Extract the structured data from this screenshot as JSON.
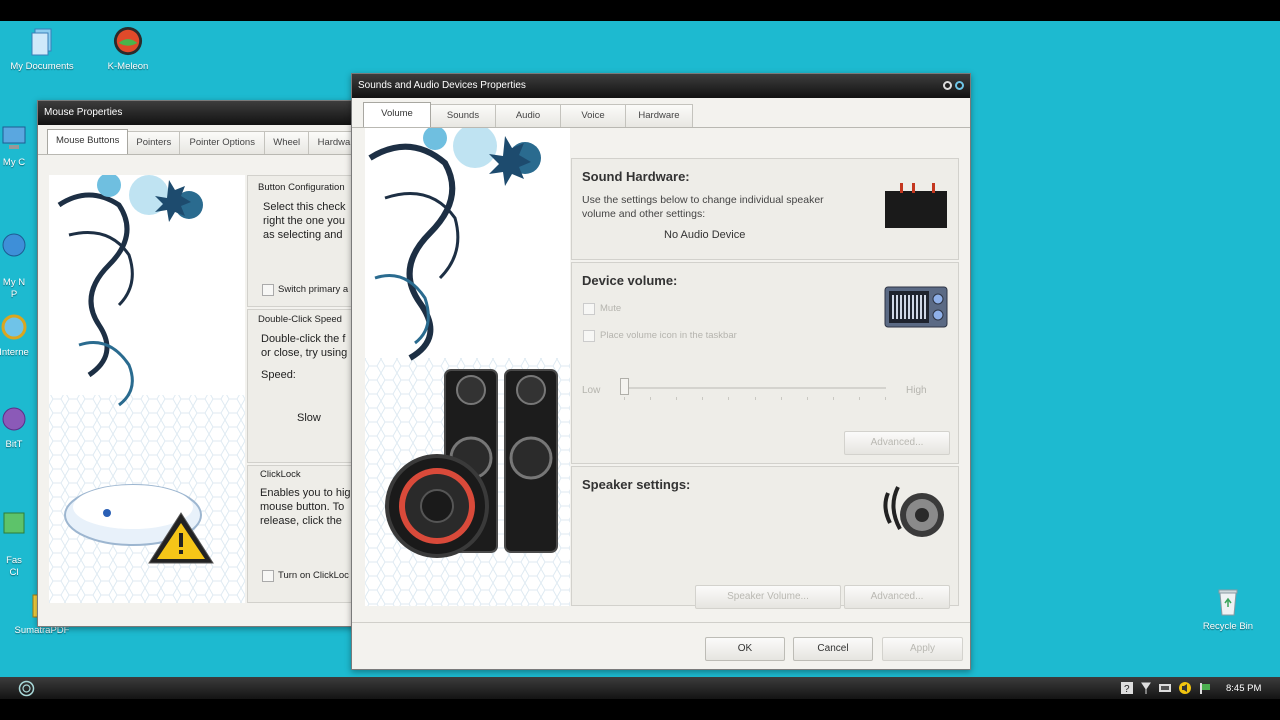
{
  "desktop": {
    "icons": [
      {
        "label": "My Documents",
        "icon": "documents-icon"
      },
      {
        "label": "K-Meleon",
        "icon": "k-meleon-icon"
      },
      {
        "label": "My C",
        "icon": "computer-icon"
      },
      {
        "label": "My N\nP",
        "icon": "network-icon"
      },
      {
        "label": "Interne",
        "icon": "internet-icon"
      },
      {
        "label": "BitT",
        "icon": "bittorrent-icon"
      },
      {
        "label": "Fas\nCl",
        "icon": "app-icon"
      },
      {
        "label": "SumatraPDF",
        "icon": "sumatrapdf-icon"
      },
      {
        "label": "Recycle Bin",
        "icon": "recycle-bin-icon"
      }
    ]
  },
  "mouse_window": {
    "title": "Mouse Properties",
    "tabs": [
      "Mouse Buttons",
      "Pointers",
      "Pointer Options",
      "Wheel",
      "Hardware"
    ],
    "button_config": {
      "title": "Button Configuration",
      "text": "Select this check\nright the one you\nas selecting and",
      "checkbox": "Switch primary a"
    },
    "double_click": {
      "title": "Double-Click Speed",
      "text": "Double-click the f\nor close, try using",
      "speed_label": "Speed:",
      "slow_label": "Slow"
    },
    "clicklock": {
      "title": "ClickLock",
      "text": "Enables you to hig\nmouse button. To\nrelease, click the",
      "checkbox": "Turn on ClickLoc"
    }
  },
  "sound_window": {
    "title": "Sounds and Audio Devices Properties",
    "tabs": [
      "Volume",
      "Sounds",
      "Audio",
      "Voice",
      "Hardware"
    ],
    "sound_hardware": {
      "title": "Sound Hardware:",
      "text": "Use the settings below to change individual speaker\nvolume and other settings:",
      "device": "No Audio Device"
    },
    "device_volume": {
      "title": "Device volume:",
      "mute": "Mute",
      "taskbar": "Place volume icon in the taskbar",
      "low": "Low",
      "high": "High",
      "volume_level": 0.0,
      "advanced": "Advanced..."
    },
    "speaker_settings": {
      "title": "Speaker settings:",
      "speaker_volume": "Speaker Volume...",
      "advanced": "Advanced..."
    },
    "buttons": {
      "ok": "OK",
      "cancel": "Cancel",
      "apply": "Apply"
    }
  },
  "taskbar": {
    "clock": "8:45 PM",
    "tray_icons": [
      "help-icon",
      "network-icon",
      "battery-icon",
      "volume-icon",
      "flag-icon"
    ]
  },
  "colors": {
    "desktop": "#1dbad0",
    "titlebar": "#1a1a1a",
    "window_body": "#f3f2ee"
  }
}
